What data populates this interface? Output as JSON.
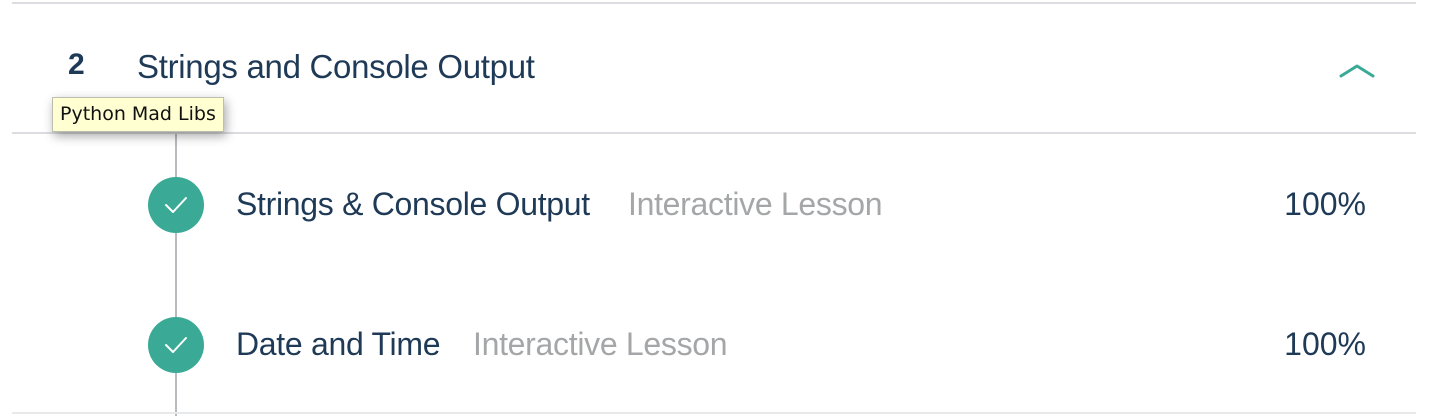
{
  "unit": {
    "number": "2",
    "title": "Strings and Console Output",
    "toggle_icon": "chevron-up-icon"
  },
  "tooltip": {
    "text": "Python Mad Libs"
  },
  "lessons": [
    {
      "title": "Strings & Console Output",
      "type": "Interactive Lesson",
      "progress": "100%",
      "status_icon": "check-icon"
    },
    {
      "title": "Date and Time",
      "type": "Interactive Lesson",
      "progress": "100%",
      "status_icon": "check-icon"
    }
  ],
  "colors": {
    "accent": "#3aaa96",
    "heading": "#1f3a57",
    "muted": "#a4a6a8",
    "tooltip_bg": "#ffffd2"
  }
}
